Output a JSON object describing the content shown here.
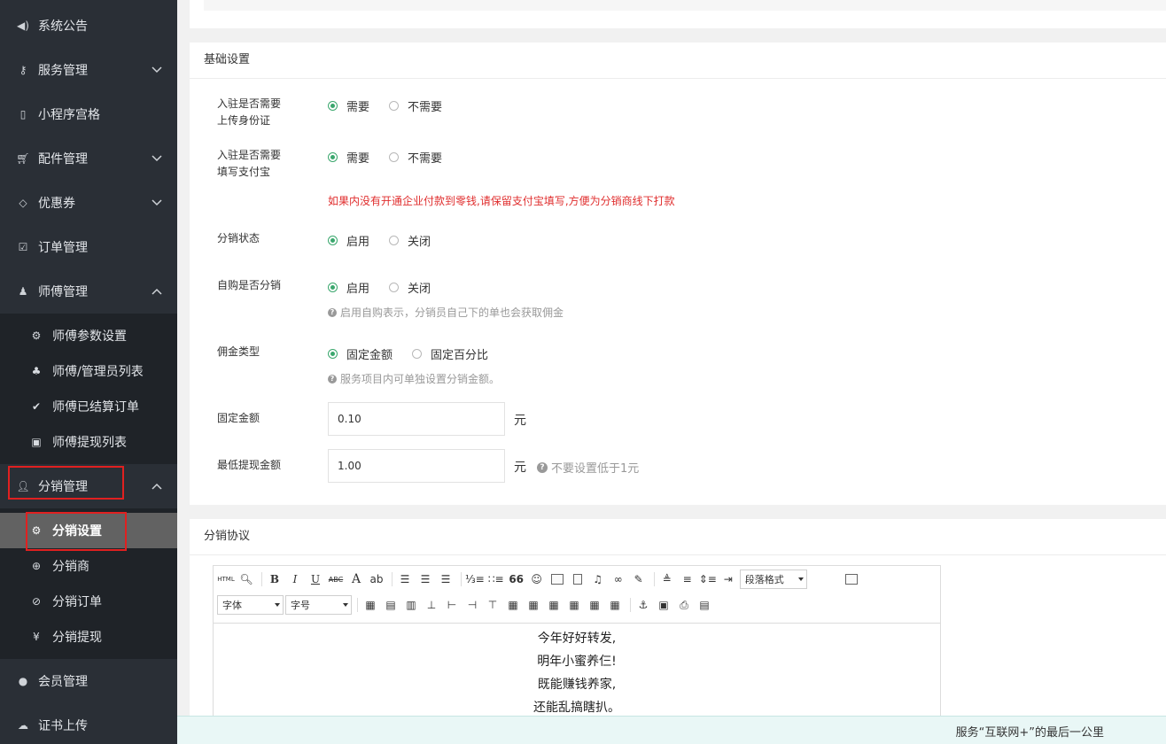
{
  "sidebar": {
    "items": [
      {
        "label": "系统公告",
        "icon": "volume-icon"
      },
      {
        "label": "服务管理",
        "icon": "key-icon",
        "chevron": "down"
      },
      {
        "label": "小程序宫格",
        "icon": "mobile-icon"
      },
      {
        "label": "配件管理",
        "icon": "cart-icon",
        "chevron": "down"
      },
      {
        "label": "优惠券",
        "icon": "diamond-icon",
        "chevron": "down"
      },
      {
        "label": "订单管理",
        "icon": "check-square-icon"
      },
      {
        "label": "师傅管理",
        "icon": "user-tie-icon",
        "chevron": "up"
      },
      {
        "label": "分销管理",
        "icon": "user-plus-icon",
        "chevron": "up"
      },
      {
        "label": "会员管理",
        "icon": "user-icon"
      },
      {
        "label": "证书上传",
        "icon": "cloud-upload-icon"
      }
    ],
    "master_sub": [
      {
        "label": "师傅参数设置",
        "icon": "gear-icon"
      },
      {
        "label": "师傅/管理员列表",
        "icon": "sitemap-icon"
      },
      {
        "label": "师傅已结算订单",
        "icon": "check-circle-icon"
      },
      {
        "label": "师傅提现列表",
        "icon": "money-icon"
      }
    ],
    "dist_sub": [
      {
        "label": "分销设置",
        "icon": "gear-icon"
      },
      {
        "label": "分销商",
        "icon": "plus-circle-icon"
      },
      {
        "label": "分销订单",
        "icon": "check-circle-icon"
      },
      {
        "label": "分销提现",
        "icon": "yen-icon"
      }
    ]
  },
  "basic": {
    "title": "基础设置",
    "id_card": {
      "label_line1": "入驻是否需要",
      "label_line2": "上传身份证",
      "opt_yes": "需要",
      "opt_no": "不需要",
      "selected": "需要"
    },
    "alipay": {
      "label_line1": "入驻是否需要",
      "label_line2": "填写支付宝",
      "opt_yes": "需要",
      "opt_no": "不需要",
      "selected": "需要"
    },
    "alipay_warn": "如果内没有开通企业付款到零钱,请保留支付宝填写,方便为分销商线下打款",
    "dist_status": {
      "label": "分销状态",
      "opt_on": "启用",
      "opt_off": "关闭",
      "selected": "启用"
    },
    "self_buy": {
      "label": "自购是否分销",
      "opt_on": "启用",
      "opt_off": "关闭",
      "selected": "启用",
      "help": "启用自购表示，分销员自己下的单也会获取佣金"
    },
    "commission": {
      "label": "佣金类型",
      "opt_fixed": "固定金额",
      "opt_percent": "固定百分比",
      "selected": "固定金额",
      "help": "服务项目内可单独设置分销金额。"
    },
    "fixed_amount": {
      "label": "固定金额",
      "value": "0.10",
      "unit": "元"
    },
    "min_withdraw": {
      "label": "最低提现金额",
      "value": "1.00",
      "unit": "元",
      "help": "不要设置低于1元"
    }
  },
  "agreement": {
    "title": "分销协议",
    "toolbar": {
      "html": "HTML",
      "bold": "B",
      "italic": "I",
      "underline": "U",
      "strike": "ABC",
      "font_color": "A",
      "quote": "66",
      "paragraph": "段落格式",
      "font_family": "字体",
      "font_size": "字号"
    },
    "content": [
      "今年好好转发,",
      "明年小蜜养仨!",
      "既能赚钱养家,",
      "还能乱搞瞎扒。"
    ]
  },
  "footer": {
    "text": "服务“互联网+”的最后一公里"
  },
  "colors": {
    "accent": "#3aa76d",
    "highlight": "#e02020",
    "sidebar": "#2a2f36",
    "warn": "#e02e2e"
  }
}
